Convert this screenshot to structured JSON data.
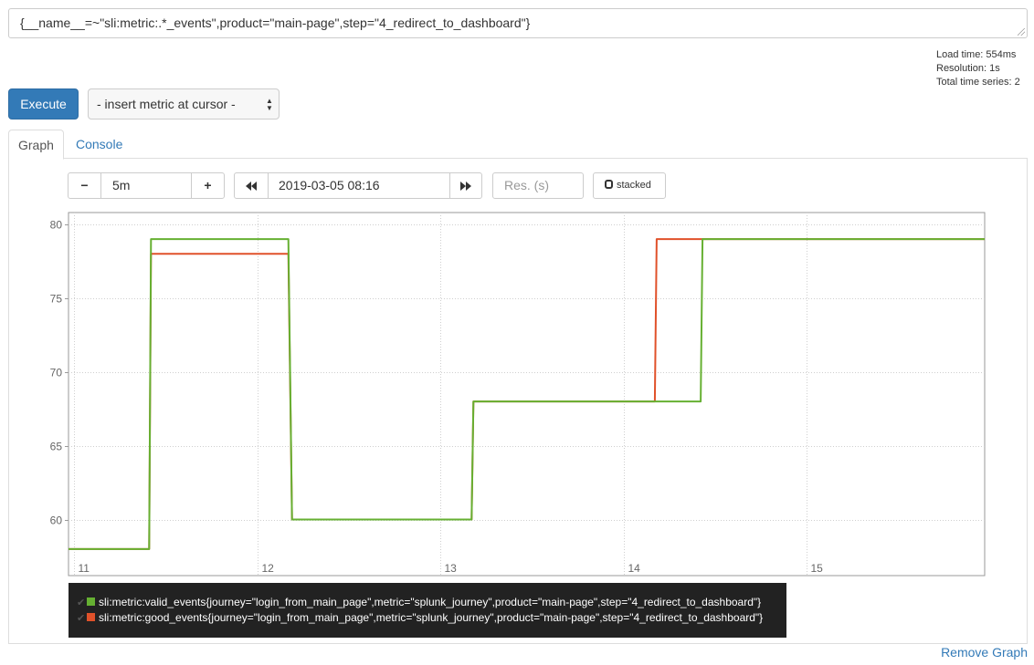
{
  "expression": "{__name__=~\"sli:metric:.*_events\",product=\"main-page\",step=\"4_redirect_to_dashboard\"}",
  "stats": {
    "load_time": "Load time: 554ms",
    "resolution": "Resolution: 1s",
    "total_series": "Total time series: 2"
  },
  "controls": {
    "execute_label": "Execute",
    "metric_select_value": "- insert metric at cursor -"
  },
  "tabs": [
    {
      "label": "Graph",
      "active": true
    },
    {
      "label": "Console",
      "active": false
    }
  ],
  "graph_controls": {
    "minus_label": "−",
    "range_value": "5m",
    "plus_label": "+",
    "back_icon": "double-chevron-left-icon",
    "end_time_value": "2019-03-05 08:16",
    "forward_icon": "double-chevron-right-icon",
    "resolution_placeholder": "Res. (s)",
    "stacked_label": "stacked"
  },
  "colors": {
    "valid_events": "#66b032",
    "good_events": "#e0512a",
    "accent": "#337ab7"
  },
  "chart_data": {
    "type": "line",
    "grid": true,
    "xlim": [
      10.97,
      15.97
    ],
    "ylim": [
      56.2,
      80.8
    ],
    "x_ticks": [
      11,
      12,
      13,
      14,
      15
    ],
    "x_tick_labels": [
      "11",
      "12",
      "13",
      "14",
      "15"
    ],
    "y_ticks": [
      60,
      65,
      70,
      75,
      80
    ],
    "y_tick_labels": [
      "60",
      "65",
      "70",
      "75",
      "80"
    ],
    "series": [
      {
        "name": "sli:metric:good_events{journey=\"login_from_main_page\",metric=\"splunk_journey\",product=\"main-page\",step=\"4_redirect_to_dashboard\"}",
        "color": "#e0512a",
        "points": [
          [
            10.97,
            58
          ],
          [
            11.41,
            58
          ],
          [
            11.42,
            78
          ],
          [
            12.17,
            78
          ],
          [
            12.19,
            60
          ],
          [
            13.17,
            60
          ],
          [
            13.18,
            68
          ],
          [
            14.17,
            68
          ],
          [
            14.18,
            79
          ],
          [
            15.97,
            79
          ]
        ]
      },
      {
        "name": "sli:metric:valid_events{journey=\"login_from_main_page\",metric=\"splunk_journey\",product=\"main-page\",step=\"4_redirect_to_dashboard\"}",
        "color": "#66b032",
        "points": [
          [
            10.97,
            58
          ],
          [
            11.41,
            58
          ],
          [
            11.42,
            79
          ],
          [
            12.17,
            79
          ],
          [
            12.19,
            60
          ],
          [
            13.17,
            60
          ],
          [
            13.18,
            68
          ],
          [
            14.42,
            68
          ],
          [
            14.43,
            79
          ],
          [
            15.97,
            79
          ]
        ]
      }
    ]
  },
  "legend": [
    {
      "label": "sli:metric:valid_events{journey=\"login_from_main_page\",metric=\"splunk_journey\",product=\"main-page\",step=\"4_redirect_to_dashboard\"}",
      "color": "#66b032"
    },
    {
      "label": "sli:metric:good_events{journey=\"login_from_main_page\",metric=\"splunk_journey\",product=\"main-page\",step=\"4_redirect_to_dashboard\"}",
      "color": "#e0512a"
    }
  ],
  "remove_graph_label": "Remove Graph"
}
